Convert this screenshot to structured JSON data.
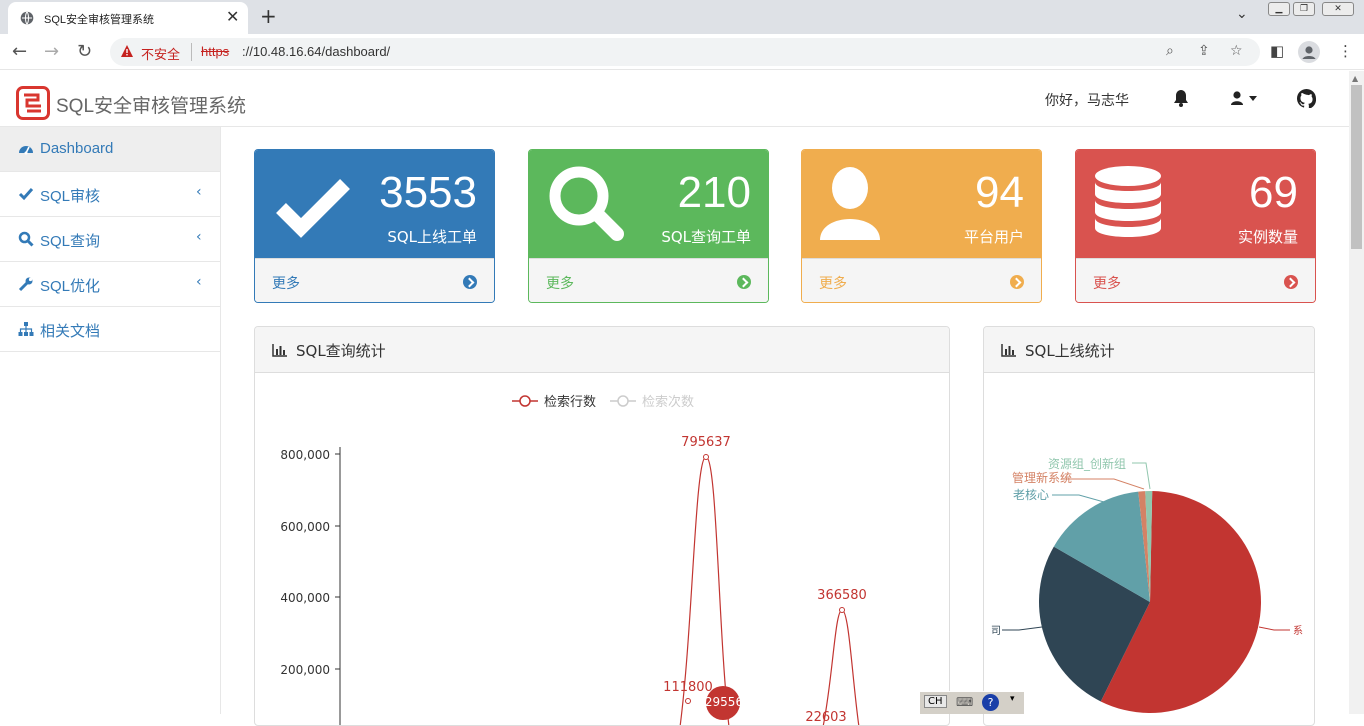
{
  "browser": {
    "tab_title": "SQL安全审核管理系统",
    "tab_close": "✕",
    "new_tab": "+",
    "insecure_label": "不安全",
    "url_scheme": "https",
    "url_rest": "://10.48.16.64/dashboard/"
  },
  "header": {
    "brand": "SQL安全审核管理系统",
    "greeting": "你好，马志华"
  },
  "sidebar": {
    "items": [
      {
        "label": "Dashboard",
        "icon": "dashboard-icon"
      },
      {
        "label": "SQL审核",
        "icon": "check-icon"
      },
      {
        "label": "SQL查询",
        "icon": "search-icon"
      },
      {
        "label": "SQL优化",
        "icon": "wrench-icon"
      },
      {
        "label": "相关文档",
        "icon": "sitemap-icon"
      }
    ]
  },
  "stats": [
    {
      "value": "3553",
      "label": "SQL上线工单",
      "more": "更多",
      "color": "#337ab7"
    },
    {
      "value": "210",
      "label": "SQL查询工单",
      "more": "更多",
      "color": "#5cb85c"
    },
    {
      "value": "94",
      "label": "平台用户",
      "more": "更多",
      "color": "#f0ad4e"
    },
    {
      "value": "69",
      "label": "实例数量",
      "more": "更多",
      "color": "#d9534f"
    }
  ],
  "query_chart": {
    "title": "SQL查询统计",
    "legend": [
      "检索行数",
      "检索次数"
    ],
    "y_ticks": [
      "800,000",
      "600,000",
      "400,000",
      "200,000"
    ],
    "point_labels": [
      "795637",
      "366580",
      "111800",
      "29556",
      "22603"
    ]
  },
  "deploy_chart": {
    "title": "SQL上线统计",
    "slice_labels": [
      "资源组_创新组",
      "管理新系统",
      "老核心"
    ],
    "clipped_labels": [
      "司",
      "系"
    ]
  },
  "tray": {
    "ime": "CH",
    "help": "?"
  },
  "chart_data": [
    {
      "type": "line",
      "title": "SQL查询统计",
      "legend_position": "top-center",
      "series": [
        {
          "name": "检索行数",
          "labeled_points": [
            795637,
            366580,
            111800,
            29556,
            22603
          ]
        },
        {
          "name": "检索次数",
          "values": []
        }
      ],
      "y_ticks": [
        200000,
        400000,
        600000,
        800000
      ],
      "ylim": [
        0,
        800000
      ]
    },
    {
      "type": "pie",
      "title": "SQL上线统计",
      "slices": [
        {
          "label": "",
          "value": 57,
          "color": "#c23531"
        },
        {
          "label": "",
          "value": 26,
          "color": "#2f4554"
        },
        {
          "label": "老核心",
          "value": 15,
          "color": "#61a0a8"
        },
        {
          "label": "管理新系统",
          "value": 1,
          "color": "#d48265"
        },
        {
          "label": "资源组_创新组",
          "value": 1,
          "color": "#91c7ae"
        }
      ]
    }
  ]
}
